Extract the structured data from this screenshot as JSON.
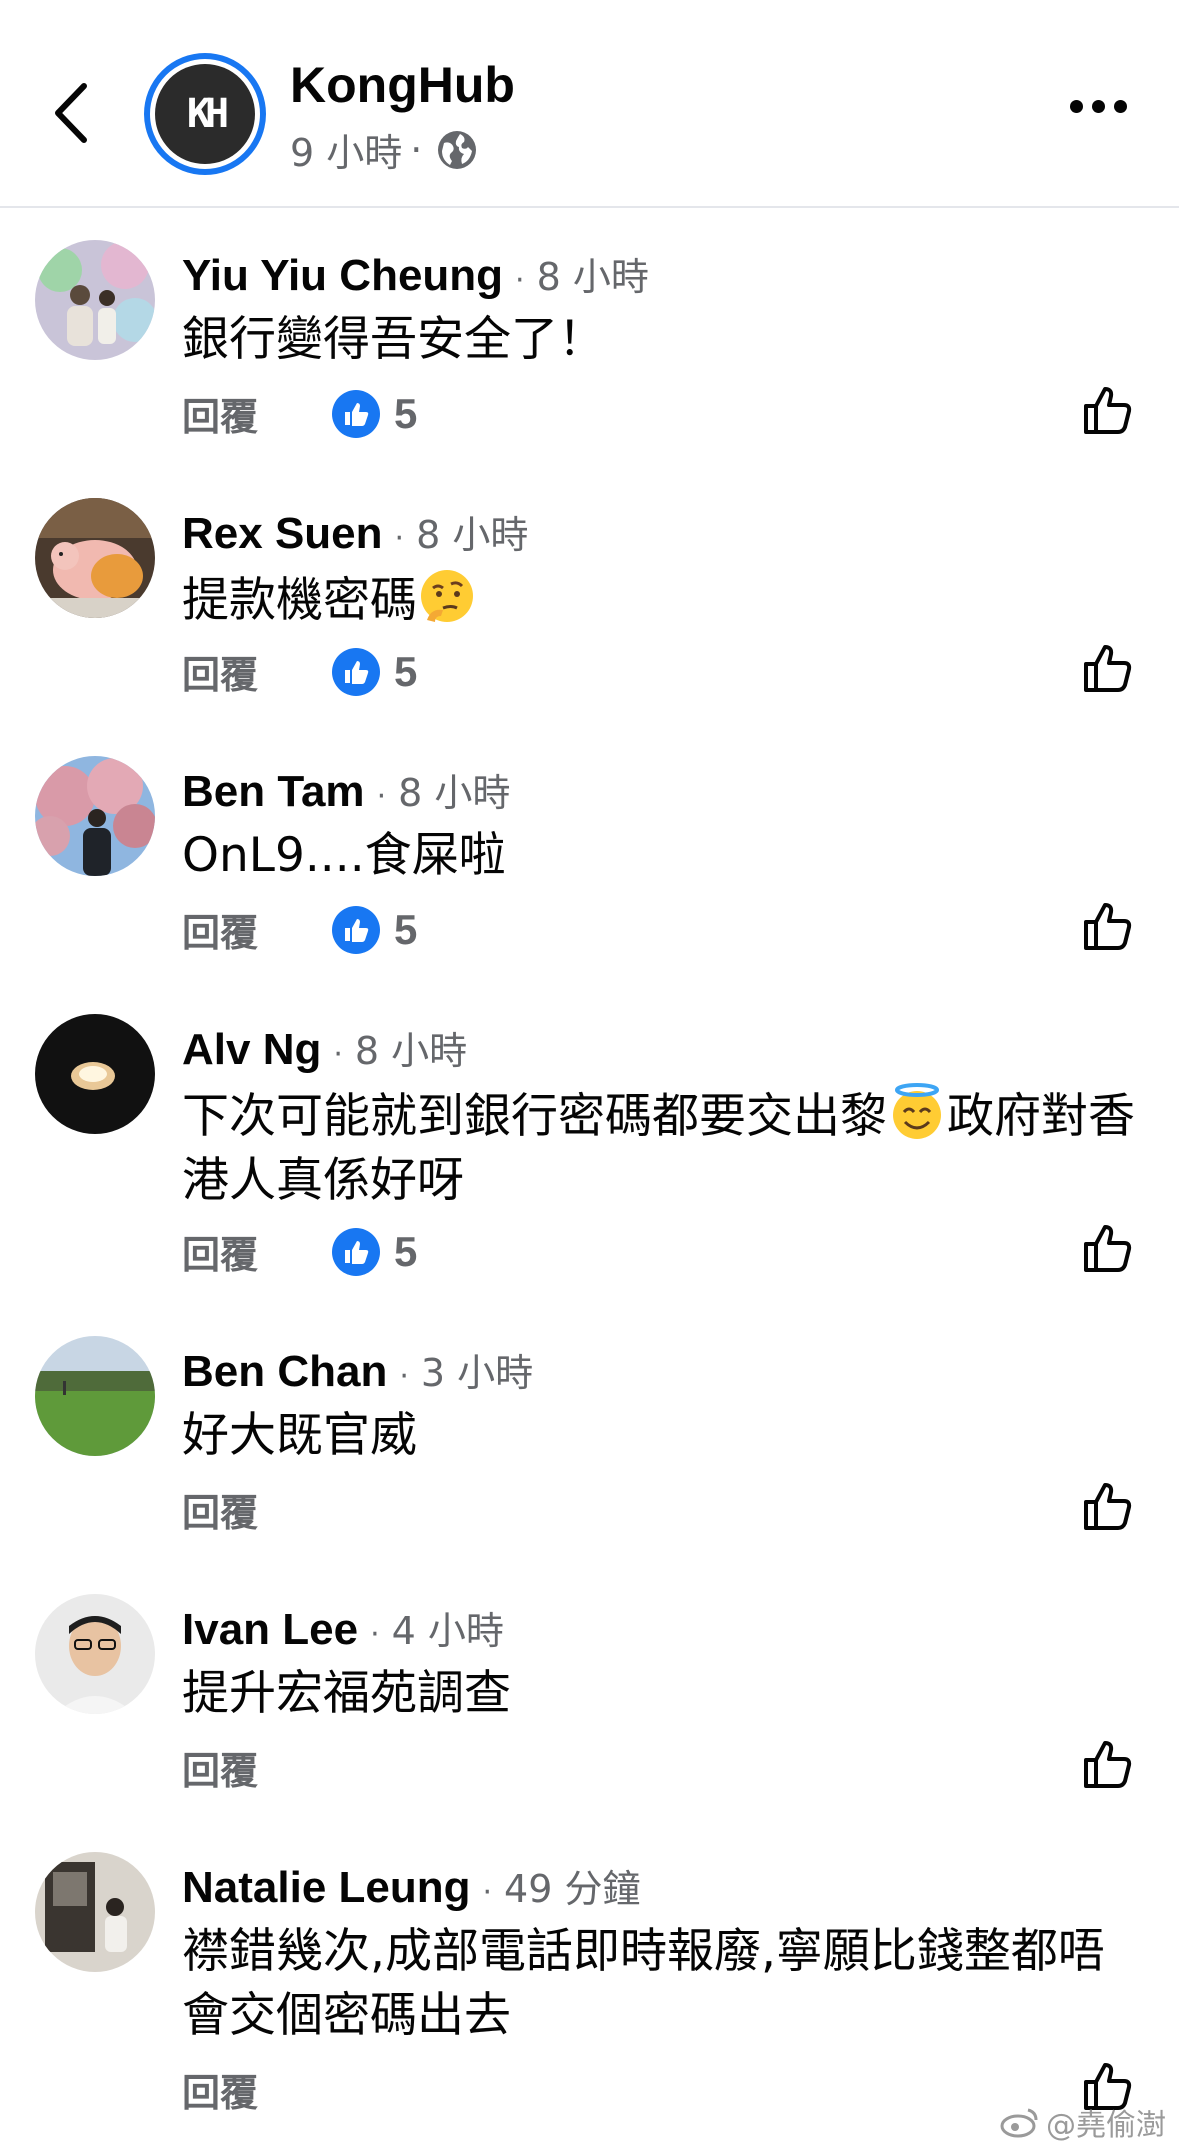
{
  "header": {
    "page_name": "KongHub",
    "time": "9 小時",
    "separator": "·",
    "logo_text": "KH"
  },
  "comments": [
    {
      "name": "Yiu Yiu Cheung",
      "time": "8 小時",
      "text": "銀行變得吾安全了！",
      "reply_label": "回覆",
      "like_count": "5"
    },
    {
      "name": "Rex Suen",
      "time": "8 小時",
      "text": "提款機密碼",
      "emoji": "thinking-face-emoji",
      "reply_label": "回覆",
      "like_count": "5"
    },
    {
      "name": "Ben Tam",
      "time": "8 小時",
      "text": "OnL9....食屎啦",
      "reply_label": "回覆",
      "like_count": "5"
    },
    {
      "name": "Alv Ng",
      "time": "8 小時",
      "text_part1": "下次可能就到銀行密碼都要交出黎",
      "emoji": "halo-face-emoji",
      "text_part2": "政府對香港人真係好呀",
      "reply_label": "回覆",
      "like_count": "5"
    },
    {
      "name": "Ben Chan",
      "time": "3 小時",
      "text": "好大既官威",
      "reply_label": "回覆"
    },
    {
      "name": "Ivan Lee",
      "time": "4 小時",
      "text": "提升宏福苑調查",
      "reply_label": "回覆"
    },
    {
      "name": "Natalie Leung",
      "time": "49 分鐘",
      "text": "襟錯幾次,成部電話即時報廢,寧願比錢整都唔會交個密碼出去",
      "reply_label": "回覆"
    }
  ],
  "separator": "·",
  "watermark": "@堯偷澍",
  "colors": {
    "accent": "#1877f2",
    "meta": "#65676b",
    "text": "#050505"
  }
}
